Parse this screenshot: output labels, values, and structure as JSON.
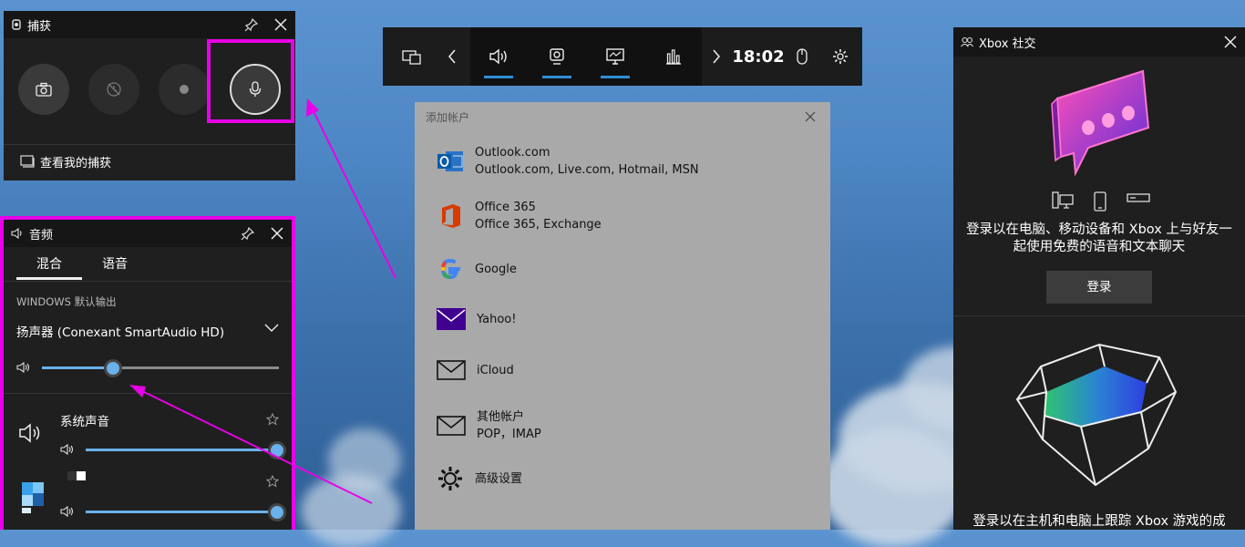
{
  "capture": {
    "title": "捕获",
    "view_captures": "查看我的捕获"
  },
  "audio": {
    "title": "音频",
    "tabs": [
      "混合",
      "语音"
    ],
    "section_label": "WINDOWS 默认输出",
    "device": "扬声器 (Conexant SmartAudio HD)",
    "master_volume": 0.3,
    "apps": [
      {
        "name": "系统声音",
        "volume": 1.0
      },
      {
        "name": "",
        "volume": 1.0
      }
    ]
  },
  "toolbar": {
    "time": "18:02"
  },
  "add_account": {
    "title": "添加帐户",
    "items": [
      {
        "name": "Outlook.com",
        "sub": "Outlook.com, Live.com, Hotmail, MSN",
        "icon": "outlook-icon"
      },
      {
        "name": "Office 365",
        "sub": "Office 365, Exchange",
        "icon": "office365-icon"
      },
      {
        "name": "Google",
        "sub": "",
        "icon": "google-icon"
      },
      {
        "name": "Yahoo!",
        "sub": "",
        "icon": "yahoo-icon"
      },
      {
        "name": "iCloud",
        "sub": "",
        "icon": "mail-icon"
      },
      {
        "name": "其他帐户",
        "sub": "POP，IMAP",
        "icon": "mail-icon"
      },
      {
        "name": "高级设置",
        "sub": "",
        "icon": "gear-icon"
      }
    ]
  },
  "xbox_social": {
    "title": "Xbox 社交",
    "message": "登录以在电脑、移动设备和 Xbox 上与好友一起使用免费的语音和文本聊天",
    "signin_label": "登录",
    "bottom_message": "登录以在主机和电脑上跟踪 Xbox 游戏的成"
  },
  "colors": {
    "accent": "#2f8ed6",
    "highlight": "#e800e8",
    "slider": "#6ab0ea"
  }
}
